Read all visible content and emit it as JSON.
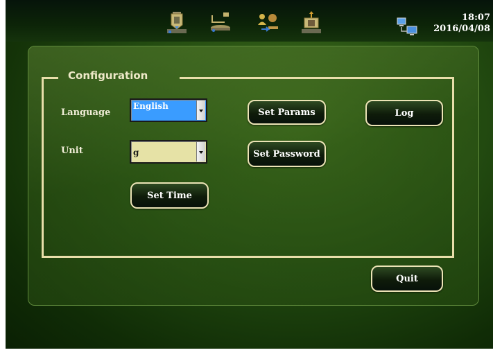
{
  "status_bar": {
    "time": "18:07",
    "date": "2016/04/08",
    "nav_icons": [
      "tank-outlet-icon",
      "conveyor-weighing-icon",
      "workers-batch-icon",
      "tank-inlet-icon"
    ],
    "network_icon": "network-computers-icon"
  },
  "configuration": {
    "title": "Configuration",
    "language_label": "Language",
    "language_value": "English",
    "unit_label": "Unit",
    "unit_value": "g",
    "set_time": "Set Time",
    "set_params": "Set Params",
    "set_password": "Set Password",
    "log": "Log"
  },
  "quit_label": "Quit",
  "colors": {
    "frame": "#e8deaa",
    "language_select_bg": "#3a9cff",
    "unit_select_bg": "#e6e2a6",
    "button_bg": "#0f1c0a"
  }
}
